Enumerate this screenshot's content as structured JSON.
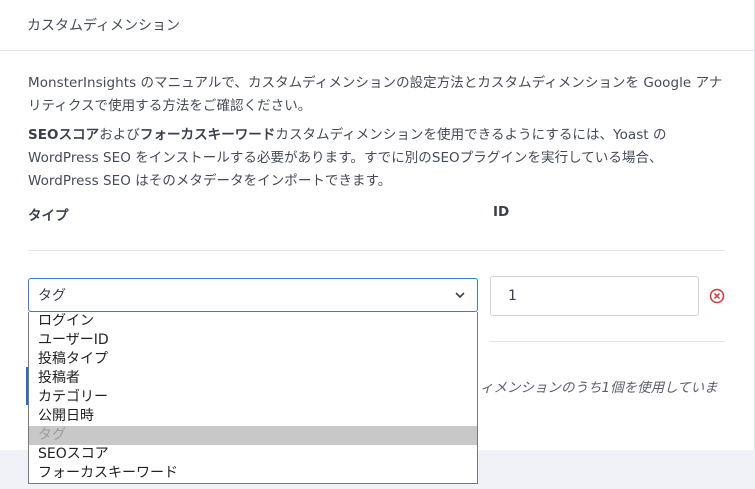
{
  "card": {
    "title": "カスタムディメンション",
    "description_1": "MonsterInsights のマニュアルで、カスタムディメンションの設定方法とカスタムディメンションを Google アナリティクスで使用する方法をご確認ください。",
    "description_2_bold_1": "SEOスコア",
    "description_2_text_1": "および",
    "description_2_bold_2": "フォーカスキーワード",
    "description_2_text_2": "カスタムディメンションを使用できるようにするには、Yoast の WordPress SEO をインストールする必要があります。すでに別のSEOプラグインを実行している場合、WordPress SEO はそのメタデータをインポートできます。"
  },
  "table": {
    "col_type": "タイプ",
    "col_id": "ID"
  },
  "row": {
    "type_value": "タグ",
    "id_value": "1"
  },
  "footer": {
    "usage_text": "ィメンションのうち1個を使用していま"
  },
  "dropdown": {
    "options": [
      {
        "label": "ログイン",
        "disabled": false
      },
      {
        "label": "ユーザーID",
        "disabled": false
      },
      {
        "label": "投稿タイプ",
        "disabled": false
      },
      {
        "label": "投稿者",
        "disabled": false
      },
      {
        "label": "カテゴリー",
        "disabled": false
      },
      {
        "label": "公開日時",
        "disabled": false
      },
      {
        "label": "タグ",
        "disabled": true
      },
      {
        "label": "SEOスコア",
        "disabled": false
      },
      {
        "label": "フォーカスキーワード",
        "disabled": false
      }
    ]
  },
  "colors": {
    "accent": "#3a7bd5",
    "remove": "#d63638"
  },
  "icons": {
    "select_arrow": "chevron-down-icon",
    "remove": "remove-circle-icon"
  }
}
